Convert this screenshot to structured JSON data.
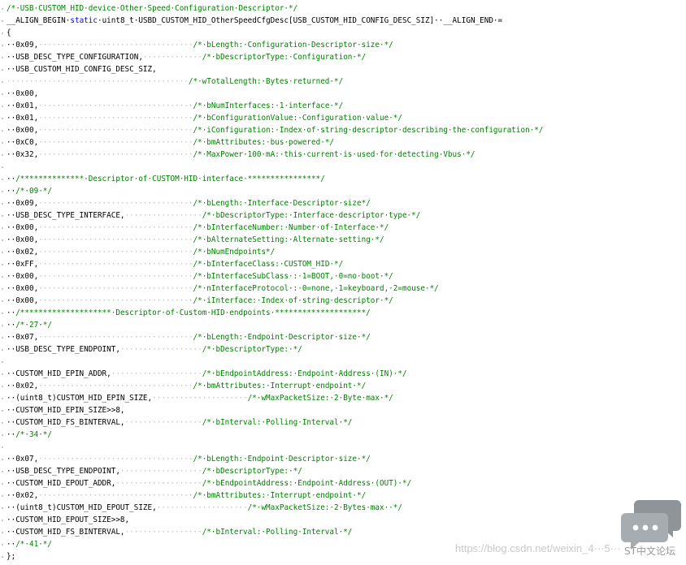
{
  "editor": {
    "lines": [
      {
        "segs": [
          {
            "c": "cmt",
            "t": "/*·USB·CUSTOM_HID·device·Other·Speed·Configuration·Descriptor·*/"
          }
        ]
      },
      {
        "segs": [
          {
            "c": "plain",
            "t": "__ALIGN_BEGIN·"
          },
          {
            "c": "kw",
            "t": "static"
          },
          {
            "c": "plain",
            "t": "·uint8_t·USBD_CUSTOM_HID_OtherSpeedCfgDesc[USB_CUSTOM_HID_CONFIG_DESC_SIZ]··__ALIGN_END·="
          }
        ]
      },
      {
        "segs": [
          {
            "c": "plain",
            "t": "{"
          }
        ]
      },
      {
        "segs": [
          {
            "c": "plain",
            "t": "··0x09,"
          },
          {
            "c": "dots",
            "t": "··································"
          },
          {
            "c": "cmt",
            "t": "/*·bLength:·Configuration·Descriptor·size·*/"
          }
        ]
      },
      {
        "segs": [
          {
            "c": "plain",
            "t": "··USB_DESC_TYPE_CONFIGURATION,"
          },
          {
            "c": "dots",
            "t": "·············"
          },
          {
            "c": "cmt",
            "t": "/*·bDescriptorType:·Configuration·*/"
          }
        ]
      },
      {
        "segs": [
          {
            "c": "plain",
            "t": "··USB_CUSTOM_HID_CONFIG_DESC_SIZ,"
          }
        ]
      },
      {
        "segs": [
          {
            "c": "dots",
            "t": "········································"
          },
          {
            "c": "cmt",
            "t": "/*·wTotalLength:·Bytes·returned·*/"
          }
        ]
      },
      {
        "segs": [
          {
            "c": "plain",
            "t": "··0x00,"
          }
        ]
      },
      {
        "segs": [
          {
            "c": "plain",
            "t": "··0x01,"
          },
          {
            "c": "dots",
            "t": "··································"
          },
          {
            "c": "cmt",
            "t": "/*·bNumInterfaces:·1·interface·*/"
          }
        ]
      },
      {
        "segs": [
          {
            "c": "plain",
            "t": "··0x01,"
          },
          {
            "c": "dots",
            "t": "··································"
          },
          {
            "c": "cmt",
            "t": "/*·bConfigurationValue:·Configuration·value·*/"
          }
        ]
      },
      {
        "segs": [
          {
            "c": "plain",
            "t": "··0x00,"
          },
          {
            "c": "dots",
            "t": "··································"
          },
          {
            "c": "cmt",
            "t": "/*·iConfiguration:·Index·of·string·descriptor·describing·the·configuration·*/"
          }
        ]
      },
      {
        "segs": [
          {
            "c": "plain",
            "t": "··0xC0,"
          },
          {
            "c": "dots",
            "t": "··································"
          },
          {
            "c": "cmt",
            "t": "/*·bmAttributes:·bus·powered·*/"
          }
        ]
      },
      {
        "segs": [
          {
            "c": "plain",
            "t": "··0x32,"
          },
          {
            "c": "dots",
            "t": "··································"
          },
          {
            "c": "cmt",
            "t": "/*·MaxPower·100·mA:·this·current·is·used·for·detecting·Vbus·*/"
          }
        ]
      },
      {
        "segs": [
          {
            "c": "plain",
            "t": ""
          }
        ]
      },
      {
        "segs": [
          {
            "c": "plain",
            "t": "··"
          },
          {
            "c": "cmt",
            "t": "/**************·Descriptor·of·CUSTOM·HID·interface·****************/"
          }
        ]
      },
      {
        "segs": [
          {
            "c": "plain",
            "t": "··"
          },
          {
            "c": "cmt",
            "t": "/*·09·*/"
          }
        ]
      },
      {
        "segs": [
          {
            "c": "plain",
            "t": "··0x09,"
          },
          {
            "c": "dots",
            "t": "··································"
          },
          {
            "c": "cmt",
            "t": "/*·bLength:·Interface·Descriptor·size*/"
          }
        ]
      },
      {
        "segs": [
          {
            "c": "plain",
            "t": "··USB_DESC_TYPE_INTERFACE,"
          },
          {
            "c": "dots",
            "t": "·················"
          },
          {
            "c": "cmt",
            "t": "/*·bDescriptorType:·Interface·descriptor·type·*/"
          }
        ]
      },
      {
        "segs": [
          {
            "c": "plain",
            "t": "··0x00,"
          },
          {
            "c": "dots",
            "t": "··································"
          },
          {
            "c": "cmt",
            "t": "/*·bInterfaceNumber:·Number·of·Interface·*/"
          }
        ]
      },
      {
        "segs": [
          {
            "c": "plain",
            "t": "··0x00,"
          },
          {
            "c": "dots",
            "t": "··································"
          },
          {
            "c": "cmt",
            "t": "/*·bAlternateSetting:·Alternate·setting·*/"
          }
        ]
      },
      {
        "segs": [
          {
            "c": "plain",
            "t": "··0x02,"
          },
          {
            "c": "dots",
            "t": "··································"
          },
          {
            "c": "cmt",
            "t": "/*·bNumEndpoints*/"
          }
        ]
      },
      {
        "segs": [
          {
            "c": "plain",
            "t": "··0xFF,"
          },
          {
            "c": "dots",
            "t": "··································"
          },
          {
            "c": "cmt",
            "t": "/*·bInterfaceClass:·CUSTOM_HID·*/"
          }
        ]
      },
      {
        "segs": [
          {
            "c": "plain",
            "t": "··0x00,"
          },
          {
            "c": "dots",
            "t": "··································"
          },
          {
            "c": "cmt",
            "t": "/*·bInterfaceSubClass·:·1=BOOT,·0=no·boot·*/"
          }
        ]
      },
      {
        "segs": [
          {
            "c": "plain",
            "t": "··0x00,"
          },
          {
            "c": "dots",
            "t": "··································"
          },
          {
            "c": "cmt",
            "t": "/*·nInterfaceProtocol·:·0=none,·1=keyboard,·2=mouse·*/"
          }
        ]
      },
      {
        "segs": [
          {
            "c": "plain",
            "t": "··0x00,"
          },
          {
            "c": "dots",
            "t": "··································"
          },
          {
            "c": "cmt",
            "t": "/*·iInterface:·Index·of·string·descriptor·*/"
          }
        ]
      },
      {
        "segs": [
          {
            "c": "plain",
            "t": "··"
          },
          {
            "c": "cmt",
            "t": "/********************·Descriptor·of·Custom·HID·endpoints·********************/"
          }
        ]
      },
      {
        "segs": [
          {
            "c": "plain",
            "t": "··"
          },
          {
            "c": "cmt",
            "t": "/*·27·*/"
          }
        ]
      },
      {
        "segs": [
          {
            "c": "plain",
            "t": "··0x07,"
          },
          {
            "c": "dots",
            "t": "··································"
          },
          {
            "c": "cmt",
            "t": "/*·bLength:·Endpoint·Descriptor·size·*/"
          }
        ]
      },
      {
        "segs": [
          {
            "c": "plain",
            "t": "··USB_DESC_TYPE_ENDPOINT,"
          },
          {
            "c": "dots",
            "t": "··················"
          },
          {
            "c": "cmt",
            "t": "/*·bDescriptorType:·*/"
          }
        ]
      },
      {
        "segs": [
          {
            "c": "plain",
            "t": ""
          }
        ]
      },
      {
        "segs": [
          {
            "c": "plain",
            "t": "··CUSTOM_HID_EPIN_ADDR,"
          },
          {
            "c": "dots",
            "t": "····················"
          },
          {
            "c": "cmt",
            "t": "/*·bEndpointAddress:·Endpoint·Address·(IN)·*/"
          }
        ]
      },
      {
        "segs": [
          {
            "c": "plain",
            "t": "··0x02,"
          },
          {
            "c": "dots",
            "t": "··································"
          },
          {
            "c": "cmt",
            "t": "/*·bmAttributes:·Interrupt·endpoint·*/"
          }
        ]
      },
      {
        "segs": [
          {
            "c": "plain",
            "t": "··(uint8_t)CUSTOM_HID_EPIN_SIZE,"
          },
          {
            "c": "dots",
            "t": "·····················"
          },
          {
            "c": "cmt",
            "t": "/*·wMaxPacketSize:·2·Byte·max·*/"
          }
        ]
      },
      {
        "segs": [
          {
            "c": "plain",
            "t": "··CUSTOM_HID_EPIN_SIZE>>8,"
          }
        ]
      },
      {
        "segs": [
          {
            "c": "plain",
            "t": "··CUSTOM_HID_FS_BINTERVAL,"
          },
          {
            "c": "dots",
            "t": "·················"
          },
          {
            "c": "cmt",
            "t": "/*·bInterval:·Polling·Interval·*/"
          }
        ]
      },
      {
        "segs": [
          {
            "c": "plain",
            "t": "··"
          },
          {
            "c": "cmt",
            "t": "/*·34·*/"
          }
        ]
      },
      {
        "segs": [
          {
            "c": "plain",
            "t": ""
          }
        ]
      },
      {
        "segs": [
          {
            "c": "plain",
            "t": "··0x07,"
          },
          {
            "c": "dots",
            "t": "··································"
          },
          {
            "c": "cmt",
            "t": "/*·bLength:·Endpoint·Descriptor·size·*/"
          }
        ]
      },
      {
        "segs": [
          {
            "c": "plain",
            "t": "··USB_DESC_TYPE_ENDPOINT,"
          },
          {
            "c": "dots",
            "t": "··················"
          },
          {
            "c": "cmt",
            "t": "/*·bDescriptorType:·*/"
          }
        ]
      },
      {
        "segs": [
          {
            "c": "plain",
            "t": "··CUSTOM_HID_EPOUT_ADDR,"
          },
          {
            "c": "dots",
            "t": "···················"
          },
          {
            "c": "cmt",
            "t": "/*·bEndpointAddress:·Endpoint·Address·(OUT)·*/"
          }
        ]
      },
      {
        "segs": [
          {
            "c": "plain",
            "t": "··0x02,"
          },
          {
            "c": "dots",
            "t": "··································"
          },
          {
            "c": "cmt",
            "t": "/*·bmAttributes:·Interrupt·endpoint·*/"
          }
        ]
      },
      {
        "segs": [
          {
            "c": "plain",
            "t": "··(uint8_t)CUSTOM_HID_EPOUT_SIZE,"
          },
          {
            "c": "dots",
            "t": "····················"
          },
          {
            "c": "cmt",
            "t": "/*·wMaxPacketSize:·2·Bytes·max··*/"
          }
        ]
      },
      {
        "segs": [
          {
            "c": "plain",
            "t": "··CUSTOM_HID_EPOUT_SIZE>>8,"
          }
        ]
      },
      {
        "segs": [
          {
            "c": "plain",
            "t": "··CUSTOM_HID_FS_BINTERVAL,"
          },
          {
            "c": "dots",
            "t": "·················"
          },
          {
            "c": "cmt",
            "t": "/*·bInterval:·Polling·Interval·*/"
          }
        ]
      },
      {
        "segs": [
          {
            "c": "plain",
            "t": "··"
          },
          {
            "c": "cmt",
            "t": "/*·41·*/"
          }
        ]
      },
      {
        "segs": [
          {
            "c": "plain",
            "t": "};"
          }
        ]
      }
    ]
  },
  "watermark": {
    "text": "https://blog.csdn.net/weixin_4···5···",
    "logo_label": "ST中文论坛"
  },
  "colors": {
    "comment": "#008000",
    "keyword": "#0000ff",
    "text": "#000000",
    "whitespace_dots": "#bdbdbd"
  }
}
